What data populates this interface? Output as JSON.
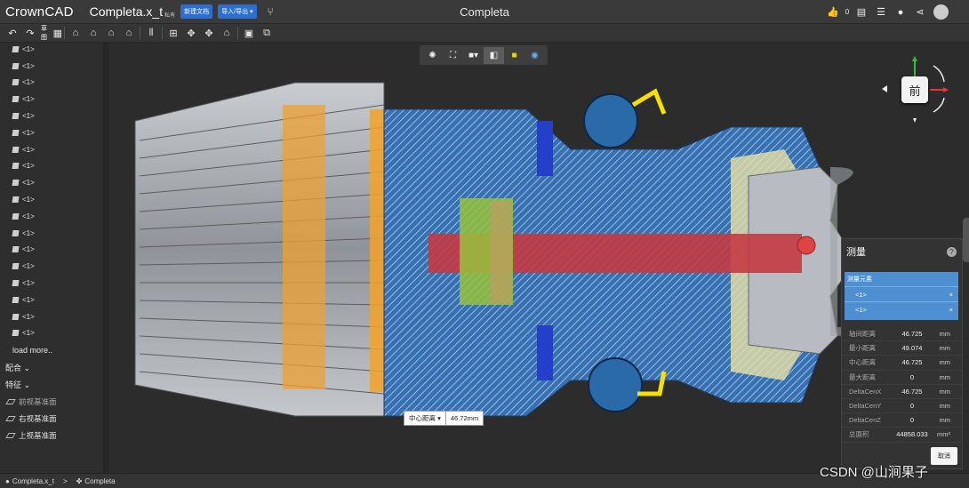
{
  "app": {
    "logo": "CrownCAD",
    "document": "Completa.x_t",
    "document_badge": "私有",
    "new_doc": "新建文档",
    "import_export": "导入/导出 ▾",
    "window_title": "Completa",
    "like_count": "0"
  },
  "toolbar": {
    "sketch_label": "草图"
  },
  "tree": {
    "items": [
      "<1>",
      "<1>",
      "<1>",
      "<1>",
      "<1>",
      "<1>",
      "<1>",
      "<1>",
      "<1>",
      "<1>",
      "<1>",
      "<1>",
      "<1>",
      "<1>",
      "<1>",
      "<1>",
      "<1>",
      "<1>"
    ],
    "load_more": "load more..",
    "assembly": "配合 ⌄",
    "feature": "特征 ⌄",
    "planes": [
      "前视基准面",
      "右视基准面",
      "上视基准面"
    ]
  },
  "navcube": {
    "face": "前"
  },
  "measure": {
    "title": "测量",
    "help": "?",
    "elements_title": "测量元素",
    "elements": [
      "<1>",
      "<1>"
    ],
    "rows": [
      {
        "k": "轴间距离",
        "v": "46.725",
        "u": "mm"
      },
      {
        "k": "最小距离",
        "v": "49.074",
        "u": "mm"
      },
      {
        "k": "中心距离",
        "v": "46.725",
        "u": "mm"
      },
      {
        "k": "最大距离",
        "v": "0",
        "u": "mm"
      },
      {
        "k": "DeltaCenX",
        "v": "46.725",
        "u": "mm"
      },
      {
        "k": "DeltaCenY",
        "v": "0",
        "u": "mm"
      },
      {
        "k": "DeltaCenZ",
        "v": "0",
        "u": "mm"
      },
      {
        "k": "总面积",
        "v": "44858.033",
        "u": "mm²"
      }
    ],
    "cancel": "取消"
  },
  "dimension_tag": {
    "mode": "中心距离 ▾",
    "value": "46.72mm"
  },
  "footer": {
    "part": "Completa.x_t",
    "sep": ">",
    "assembly": "Completa"
  },
  "watermark": "CSDN @山涧果子"
}
